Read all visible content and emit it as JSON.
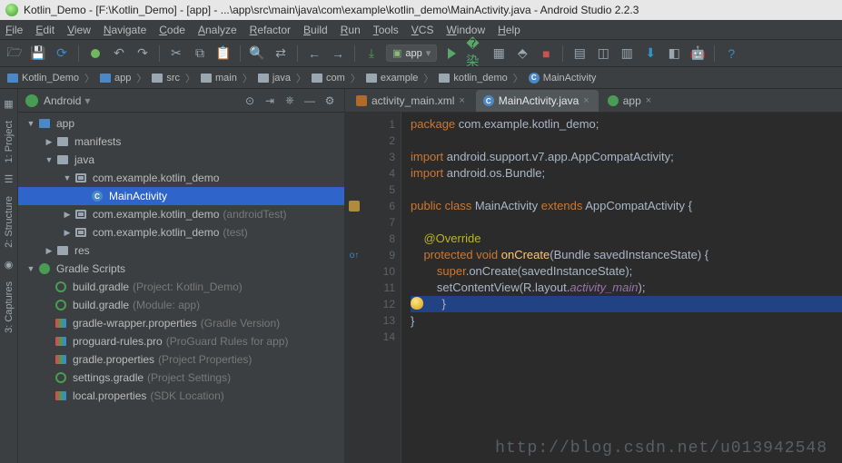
{
  "title": "Kotlin_Demo - [F:\\Kotlin_Demo] - [app] - ...\\app\\src\\main\\java\\com\\example\\kotlin_demo\\MainActivity.java - Android Studio 2.2.3",
  "menu": [
    "File",
    "Edit",
    "View",
    "Navigate",
    "Code",
    "Analyze",
    "Refactor",
    "Build",
    "Run",
    "Tools",
    "VCS",
    "Window",
    "Help"
  ],
  "runcfg": "app",
  "crumbs": [
    {
      "t": "Kotlin_Demo",
      "ic": "folder-blue"
    },
    {
      "t": "app",
      "ic": "folder-blue"
    },
    {
      "t": "src",
      "ic": "folder"
    },
    {
      "t": "main",
      "ic": "folder"
    },
    {
      "t": "java",
      "ic": "folder"
    },
    {
      "t": "com",
      "ic": "folder"
    },
    {
      "t": "example",
      "ic": "folder"
    },
    {
      "t": "kotlin_demo",
      "ic": "folder"
    },
    {
      "t": "MainActivity",
      "ic": "class"
    }
  ],
  "projhead": {
    "title": "Android"
  },
  "lefttabs": [
    "Project",
    "Structure",
    "Captures"
  ],
  "tree": [
    {
      "d": 0,
      "tw": "open",
      "ic": "mod",
      "t": "app"
    },
    {
      "d": 1,
      "tw": "closed",
      "ic": "folder",
      "t": "manifests"
    },
    {
      "d": 1,
      "tw": "open",
      "ic": "folder",
      "t": "java"
    },
    {
      "d": 2,
      "tw": "open",
      "ic": "pkg",
      "t": "com.example.kotlin_demo"
    },
    {
      "d": 3,
      "tw": "",
      "ic": "class",
      "t": "MainActivity",
      "sel": true
    },
    {
      "d": 2,
      "tw": "closed",
      "ic": "pkg",
      "t": "com.example.kotlin_demo",
      "h": "(androidTest)"
    },
    {
      "d": 2,
      "tw": "closed",
      "ic": "pkg",
      "t": "com.example.kotlin_demo",
      "h": "(test)"
    },
    {
      "d": 1,
      "tw": "closed",
      "ic": "folder",
      "t": "res"
    },
    {
      "d": 0,
      "tw": "open",
      "ic": "green",
      "t": "Gradle Scripts"
    },
    {
      "d": 1,
      "tw": "",
      "ic": "gradle",
      "t": "build.gradle",
      "h": "(Project: Kotlin_Demo)"
    },
    {
      "d": 1,
      "tw": "",
      "ic": "gradle",
      "t": "build.gradle",
      "h": "(Module: app)"
    },
    {
      "d": 1,
      "tw": "",
      "ic": "prop",
      "t": "gradle-wrapper.properties",
      "h": "(Gradle Version)"
    },
    {
      "d": 1,
      "tw": "",
      "ic": "prop",
      "t": "proguard-rules.pro",
      "h": "(ProGuard Rules for app)"
    },
    {
      "d": 1,
      "tw": "",
      "ic": "prop",
      "t": "gradle.properties",
      "h": "(Project Properties)"
    },
    {
      "d": 1,
      "tw": "",
      "ic": "gradle",
      "t": "settings.gradle",
      "h": "(Project Settings)"
    },
    {
      "d": 1,
      "tw": "",
      "ic": "prop",
      "t": "local.properties",
      "h": "(SDK Location)"
    }
  ],
  "tabs": [
    {
      "t": "activity_main.xml",
      "ic": "xml",
      "active": false
    },
    {
      "t": "MainActivity.java",
      "ic": "class",
      "active": true
    },
    {
      "t": "app",
      "ic": "circ",
      "active": false
    }
  ],
  "code": {
    "lines": [
      {
        "n": 1,
        "html": "<span class='kw'>package</span> com.example.kotlin_demo;"
      },
      {
        "n": 2,
        "html": ""
      },
      {
        "n": 3,
        "html": "<span class='kw'>import</span> android.support.v7.app.AppCompatActivity;",
        "fold": "-"
      },
      {
        "n": 4,
        "html": "<span class='kw'>import</span> android.os.Bundle;",
        "fold": "⎵"
      },
      {
        "n": 5,
        "html": ""
      },
      {
        "n": 6,
        "html": "<span class='kw'>public class</span> MainActivity <span class='kw'>extends</span> AppCompatActivity {",
        "icon": "run",
        "fold": "-"
      },
      {
        "n": 7,
        "html": ""
      },
      {
        "n": 8,
        "html": "    <span class='ann'>@Override</span>"
      },
      {
        "n": 9,
        "html": "    <span class='kw'>protected void</span> <span class='fn'>onCreate</span>(Bundle savedInstanceState) {",
        "icon": "override",
        "fold": "-"
      },
      {
        "n": 10,
        "html": "        <span class='kw'>super</span>.onCreate(savedInstanceState);"
      },
      {
        "n": 11,
        "html": "        setContentView(R.layout.<span class='field'>activity_main</span>);"
      },
      {
        "n": 12,
        "html": "    }",
        "hl": true,
        "bulb": true
      },
      {
        "n": 13,
        "html": "}"
      },
      {
        "n": 14,
        "html": ""
      }
    ]
  },
  "watermark": "http://blog.csdn.net/u013942548"
}
